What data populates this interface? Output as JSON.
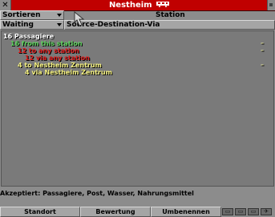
{
  "window": {
    "title": "Nestheim",
    "title_icon": "tram-icon"
  },
  "controls": {
    "sort_label": "Sortieren",
    "sort_by": "Station",
    "view_mode": "Waiting",
    "grouping": "Source-Destination-Via"
  },
  "tree": [
    {
      "text": "16 Passagiere",
      "color": "#ffffff",
      "indent": 0,
      "dash": false
    },
    {
      "text": "16 from this station",
      "color": "#5fd35f",
      "indent": 1,
      "dash": true
    },
    {
      "text": "12 to any station",
      "color": "#e02020",
      "indent": 2,
      "dash": true
    },
    {
      "text": "12 via any station",
      "color": "#e02020",
      "indent": 3,
      "dash": false
    },
    {
      "text": "4 to Nestheim Zentrum",
      "color": "#f4f080",
      "indent": 2,
      "dash": true
    },
    {
      "text": "4 via Nestheim Zentrum",
      "color": "#f4f080",
      "indent": 3,
      "dash": false
    }
  ],
  "dash_glyph": "–",
  "accepts": "Akzeptiert: Passagiere, Post, Wasser, Nahrungsmittel",
  "toolbar": {
    "location_label": "Standort",
    "ratings_label": "Bewertung",
    "rename_label": "Umbenennen"
  },
  "station_icons": [
    "truck-icon",
    "bus-icon",
    "train-icon",
    "airplane-icon"
  ],
  "colors": {
    "title_bar": "#c00000",
    "panel": "#8c8c8c"
  }
}
